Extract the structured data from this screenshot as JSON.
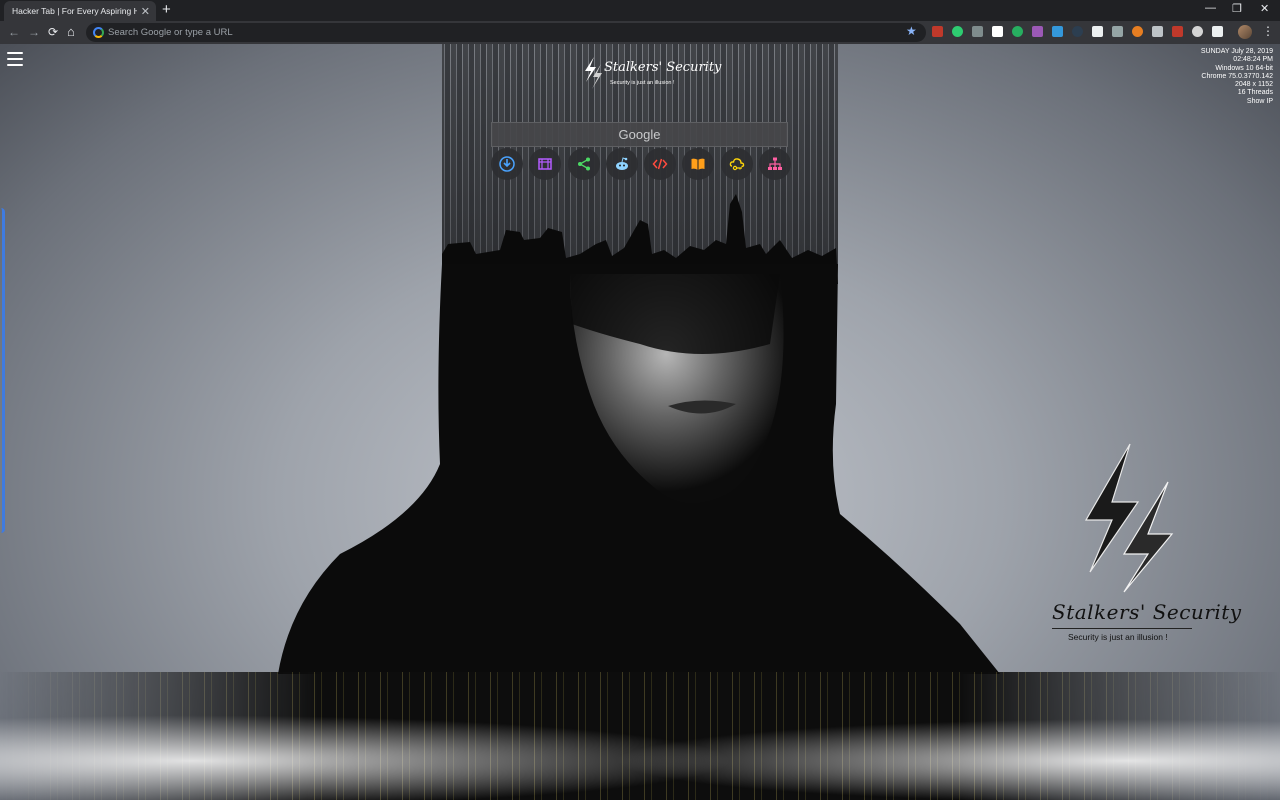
{
  "browser": {
    "tab_title": "Hacker Tab | For Every Aspiring Hacker",
    "tab_close": "✕",
    "new_tab": "+",
    "win_min": "—",
    "win_restore": "❐",
    "win_close": "✕",
    "back": "←",
    "forward": "→",
    "reload": "⟳",
    "home": "⌂",
    "omnibox_placeholder": "Search Google or type a URL",
    "bookmark_star": "★",
    "menu": "⋮",
    "extension_colors": [
      "#c0392b",
      "#2ecc71",
      "#7f8c8d",
      "#ffffff",
      "#27ae60",
      "#9b59b6",
      "#3498db",
      "#2c3e50",
      "#ecf0f1",
      "#95a5a6",
      "#e67e22",
      "#bdc3c7",
      "#c0392b",
      "#d4d4d4",
      "#ecf0f1"
    ]
  },
  "sysinfo": {
    "date": "SUNDAY July 28, 2019",
    "time": "02:48:24 PM",
    "os": "Windows 10 64-bit",
    "browser": "Chrome 75.0.3770.142",
    "resolution": "2048 x 1152",
    "threads": "16 Threads",
    "show_ip": "Show IP"
  },
  "header_logo": {
    "title": "Stalkers' Security",
    "tagline": "Security is just an illusion !"
  },
  "search": {
    "label": "Google"
  },
  "shortcuts": [
    {
      "name": "download-icon",
      "color": "#4aa3ff"
    },
    {
      "name": "media-icon",
      "color": "#b35cff"
    },
    {
      "name": "share-icon",
      "color": "#4cd964"
    },
    {
      "name": "reddit-icon",
      "color": "#8fd3ff"
    },
    {
      "name": "code-icon",
      "color": "#ff4b3e"
    },
    {
      "name": "book-icon",
      "color": "#ff9f1a"
    },
    {
      "name": "cloud-key-icon",
      "color": "#ffd60a"
    },
    {
      "name": "sitemap-icon",
      "color": "#ff5fa2"
    }
  ],
  "brand": {
    "title": "Stalkers' Security",
    "tagline": "Security is just an illusion !"
  }
}
